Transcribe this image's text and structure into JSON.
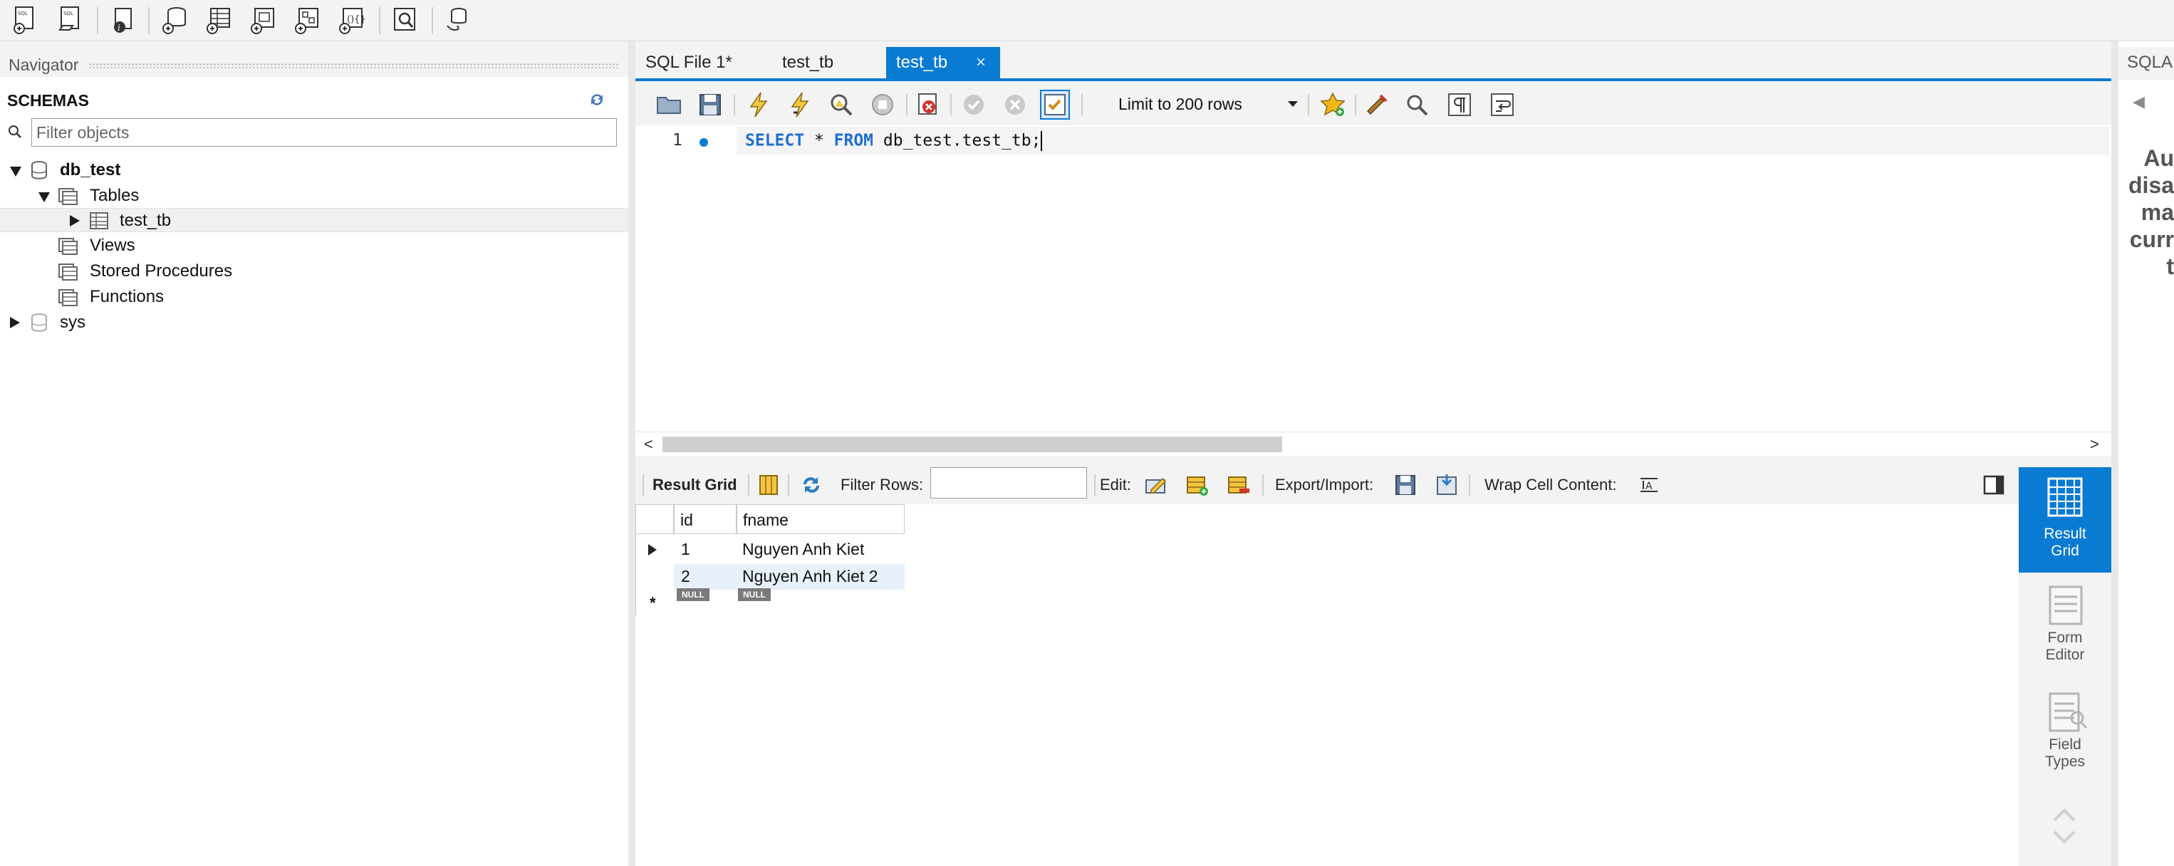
{
  "toolbar": {
    "buttons": [
      "new-sql-tab-icon",
      "open-sql-file-icon",
      "inspector-icon",
      "create-schema-icon",
      "create-table-icon",
      "create-view-icon",
      "create-procedure-icon",
      "create-function-icon",
      "search-table-data-icon",
      "reconnect-icon"
    ]
  },
  "navigator": {
    "title": "Navigator",
    "schemas_label": "SCHEMAS",
    "filter_placeholder": "Filter objects",
    "tree": [
      {
        "label": "db_test",
        "type": "schema",
        "expanded": true
      },
      {
        "label": "Tables",
        "type": "folder",
        "expanded": true
      },
      {
        "label": "test_tb",
        "type": "table",
        "expanded": false,
        "selected": true
      },
      {
        "label": "Views",
        "type": "folder"
      },
      {
        "label": "Stored Procedures",
        "type": "folder"
      },
      {
        "label": "Functions",
        "type": "folder"
      },
      {
        "label": "sys",
        "type": "schema",
        "expanded": false
      }
    ]
  },
  "tabs": [
    {
      "label": "SQL File 1*",
      "active": false
    },
    {
      "label": "test_tb",
      "active": false
    },
    {
      "label": "test_tb",
      "active": true,
      "close": "×"
    }
  ],
  "sql_toolbar": {
    "limit_label": "Limit to 200 rows"
  },
  "editor": {
    "line_number": "1",
    "keyword_select": "SELECT",
    "star": " * ",
    "keyword_from": "FROM",
    "table_ref": " db_test.test_tb;"
  },
  "scrollbar": {
    "left_arrow": "<",
    "right_arrow": ">"
  },
  "result_toolbar": {
    "result_grid_label": "Result Grid",
    "filter_rows_label": "Filter Rows:",
    "edit_label": "Edit:",
    "export_import_label": "Export/Import:",
    "wrap_label": "Wrap Cell Content:"
  },
  "result_grid": {
    "columns": [
      "id",
      "fname"
    ],
    "rows": [
      {
        "id": "1",
        "fname": "Nguyen Anh Kiet"
      },
      {
        "id": "2",
        "fname": "Nguyen Anh Kiet 2"
      }
    ],
    "new_row_marker": "*",
    "null_label": "NULL"
  },
  "side_panel": {
    "result_grid": [
      "Result",
      "Grid"
    ],
    "form_editor": [
      "Form",
      "Editor"
    ],
    "field_types": [
      "Field",
      "Types"
    ]
  },
  "assistant": {
    "title": "SQLA",
    "back_arrow": "◀",
    "lines": [
      "Au",
      "disa",
      "ma",
      "curr",
      "t"
    ]
  },
  "colors": {
    "accent": "#0a7bd2",
    "keyword": "#1f6fd0",
    "null_badge": "#7a7a7a"
  }
}
